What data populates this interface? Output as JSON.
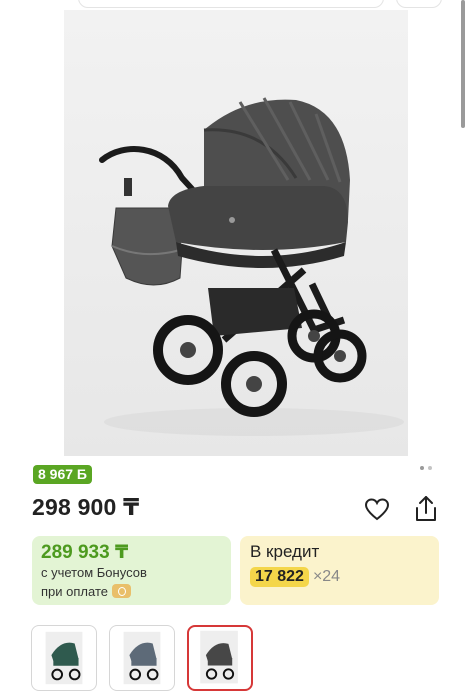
{
  "product": {
    "bonus_badge": "8 967 Б",
    "price": "298 900 ₸",
    "gallery_current": 1,
    "gallery_total": 2
  },
  "bonus_offer": {
    "price": "289 933 ₸",
    "line1": "с учетом Бонусов",
    "line2": "при оплате"
  },
  "credit_offer": {
    "title": "В кредит",
    "monthly": "17 822",
    "months": "×24"
  },
  "icons": {
    "favorite": "heart-icon",
    "share": "share-icon",
    "payment": "coin-icon"
  },
  "colors": {
    "bonus_green": "#5aa623",
    "bonus_card_bg": "#e3f4d4",
    "credit_card_bg": "#fbf3cc",
    "credit_highlight": "#f4d64a",
    "selected_thumb": "#d63838"
  },
  "thumbnails": [
    {
      "color_name": "green"
    },
    {
      "color_name": "grey-blue"
    },
    {
      "color_name": "dark-grey",
      "selected": true
    }
  ]
}
